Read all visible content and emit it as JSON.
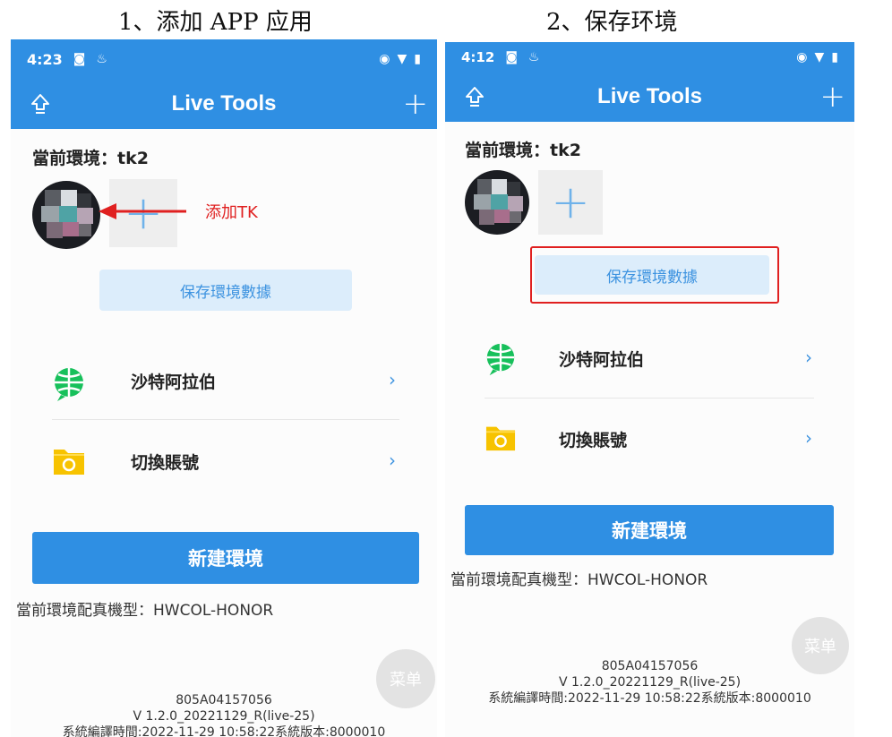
{
  "captions": {
    "step1": "1、添加 APP 应用",
    "step2": "2、保存环境"
  },
  "colors": {
    "primary": "#2f8fe3",
    "save_button_bg": "#dcedfb",
    "annotation_red": "#e02020"
  },
  "phone1": {
    "status": {
      "time": "4:23"
    },
    "appbar": {
      "title": "Live Tools",
      "left_icon": "upload-arrow-icon",
      "right_icon": "plus-icon"
    },
    "env_label": "當前環境：tk2",
    "save_label": "保存環境數據",
    "annotation": "添加TK",
    "menu_items": [
      {
        "label": "沙特阿拉伯",
        "icon": "globe-icon"
      },
      {
        "label": "切換賬號",
        "icon": "folder-icon"
      }
    ],
    "new_env_label": "新建環境",
    "model_text": "當前環境配真機型：HWCOL-HONOR",
    "menu_fab": "菜单",
    "footer": {
      "device_id": "805A04157056",
      "version": "V 1.2.0_20221129_R(live-25)",
      "build": "系統編譯時間:2022-11-29 10:58:22系統版本:8000010"
    }
  },
  "phone2": {
    "status": {
      "time": "4:12"
    },
    "appbar": {
      "title": "Live Tools",
      "left_icon": "upload-arrow-icon",
      "right_icon": "plus-icon"
    },
    "env_label": "當前環境：tk2",
    "save_label": "保存環境數據",
    "menu_items": [
      {
        "label": "沙特阿拉伯",
        "icon": "globe-icon"
      },
      {
        "label": "切換賬號",
        "icon": "folder-icon"
      }
    ],
    "new_env_label": "新建環境",
    "model_text": "當前環境配真機型：HWCOL-HONOR",
    "menu_fab": "菜单",
    "footer": {
      "device_id": "805A04157056",
      "version": "V 1.2.0_20221129_R(live-25)",
      "build": "系統編譯時間:2022-11-29 10:58:22系統版本:8000010"
    }
  }
}
